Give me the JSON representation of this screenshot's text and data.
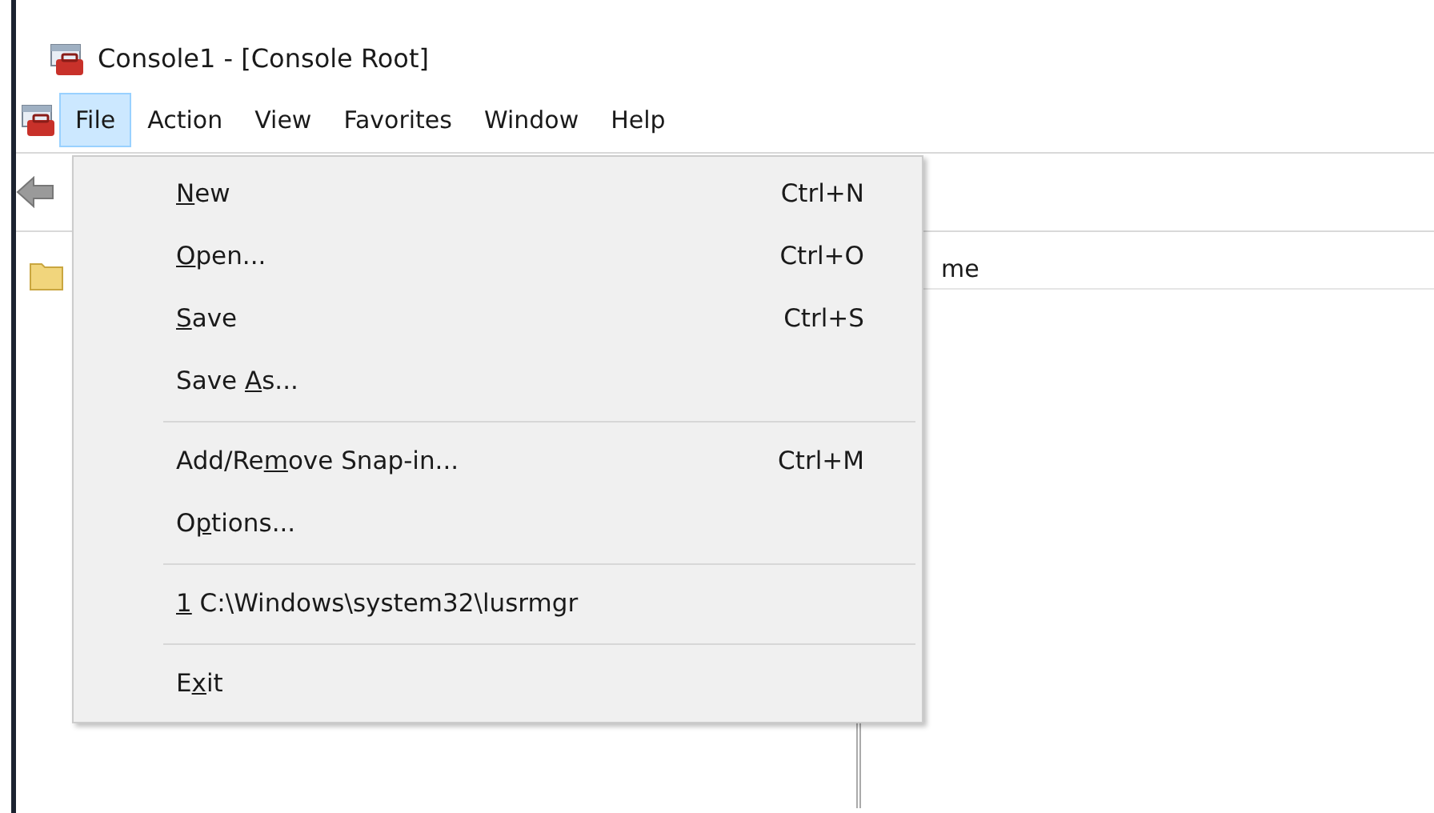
{
  "window": {
    "title": "Console1 - [Console Root]"
  },
  "menu_bar": [
    {
      "label": "File",
      "selected": true
    },
    {
      "label": "Action",
      "selected": false
    },
    {
      "label": "View",
      "selected": false
    },
    {
      "label": "Favorites",
      "selected": false
    },
    {
      "label": "Window",
      "selected": false
    },
    {
      "label": "Help",
      "selected": false
    }
  ],
  "file_menu": [
    {
      "kind": "command",
      "label_parts": [
        {
          "text": "N",
          "underline": true
        },
        {
          "text": "ew",
          "underline": false
        }
      ],
      "shortcut": "Ctrl+N"
    },
    {
      "kind": "command",
      "label_parts": [
        {
          "text": "O",
          "underline": true
        },
        {
          "text": "pen...",
          "underline": false
        }
      ],
      "shortcut": "Ctrl+O"
    },
    {
      "kind": "command",
      "label_parts": [
        {
          "text": "S",
          "underline": true
        },
        {
          "text": "ave",
          "underline": false
        }
      ],
      "shortcut": "Ctrl+S"
    },
    {
      "kind": "command",
      "label_parts": [
        {
          "text": "Save ",
          "underline": false
        },
        {
          "text": "A",
          "underline": true
        },
        {
          "text": "s...",
          "underline": false
        }
      ]
    },
    {
      "kind": "separator"
    },
    {
      "kind": "command",
      "label_parts": [
        {
          "text": "Add/Re",
          "underline": false
        },
        {
          "text": "m",
          "underline": true
        },
        {
          "text": "ove Snap-in...",
          "underline": false
        }
      ],
      "shortcut": "Ctrl+M"
    },
    {
      "kind": "command",
      "label_parts": [
        {
          "text": "O",
          "underline": false
        },
        {
          "text": "p",
          "underline": true
        },
        {
          "text": "tions...",
          "underline": false
        }
      ]
    },
    {
      "kind": "separator"
    },
    {
      "kind": "command",
      "label_parts": [
        {
          "text": "1",
          "underline": true
        },
        {
          "text": " C:\\Windows\\system32\\lusrmgr",
          "underline": false
        }
      ]
    },
    {
      "kind": "separator"
    },
    {
      "kind": "command",
      "label_parts": [
        {
          "text": "E",
          "underline": false
        },
        {
          "text": "x",
          "underline": true
        },
        {
          "text": "it",
          "underline": false
        }
      ]
    }
  ],
  "result_pane": {
    "column_header": "me"
  }
}
